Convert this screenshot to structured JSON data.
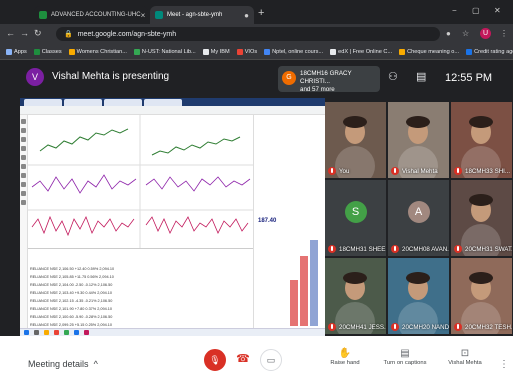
{
  "browser": {
    "tabs": [
      {
        "title": "ADVANCED ACCOUNTING-UHC",
        "icon": "classroom-icon",
        "color": "#1e8e3e"
      },
      {
        "title": "Meet - agn-sbte-ymh",
        "icon": "meet-icon",
        "color": "#00897b"
      }
    ],
    "url": "meet.google.com/agn-sbte-ymh",
    "bookmarks": [
      {
        "label": "Apps",
        "color": "#8ab4f8"
      },
      {
        "label": "Classes",
        "color": "#1e8e3e"
      },
      {
        "label": "Womens Christian...",
        "color": "#f9ab00"
      },
      {
        "label": "N-UST: National Lib...",
        "color": "#34a853"
      },
      {
        "label": "My IBM",
        "color": "#e8eaed"
      },
      {
        "label": "VIOs",
        "color": "#ea4335"
      },
      {
        "label": "Nptel, online cours...",
        "color": "#4285f4"
      },
      {
        "label": "edX | Free Online C...",
        "color": "#e8eaed"
      },
      {
        "label": "Cheque meaning o...",
        "color": "#f9ab00"
      },
      {
        "label": "Credit rating agenci...",
        "color": "#1a73e8"
      }
    ],
    "profile_initial": "U"
  },
  "meet": {
    "presenter_initial": "V",
    "presenter_text": "Vishal Mehta is presenting",
    "pinned": {
      "initial": "G",
      "name": "18CMH16 GRACY CHRISTI...",
      "more": "and 57 more"
    },
    "time": "12:55 PM",
    "participants": [
      {
        "name": "You",
        "kind": "video",
        "bg": "#6d5a4e"
      },
      {
        "name": "Vishal Mehta",
        "kind": "video",
        "bg": "#8a7d72"
      },
      {
        "name": "18CMH33 SHI...",
        "kind": "video",
        "bg": "#7c5044"
      },
      {
        "name": "18CMH31 SHEE...",
        "kind": "avatar",
        "initial": "S",
        "avatar_color": "#43a047",
        "bg": "#3c4043"
      },
      {
        "name": "20CMH08 AVAN...",
        "kind": "avatar",
        "initial": "A",
        "avatar_color": "#a1887f",
        "bg": "#3c4043"
      },
      {
        "name": "20CMH31 SWAT...",
        "kind": "video",
        "bg": "#5d4a45"
      },
      {
        "name": "20CMH41 JESS...",
        "kind": "video",
        "bg": "#4c5a4a"
      },
      {
        "name": "20CMH20 NAND...",
        "kind": "video",
        "bg": "#3f6f8a"
      },
      {
        "name": "20CMH32 TESH...",
        "kind": "video",
        "bg": "#8f6a5a"
      }
    ]
  },
  "shared_screen": {
    "table_rows": [
      "RELIANCE  NSE  2,106.50  +12.40  0.59%  2,094.10",
      "RELIANCE  NSE  2,105.85  +11.75  0.56%  2,094.10",
      "RELIANCE  NSE  2,104.00  -2.50  -0.12%  2,106.50",
      "RELIANCE  NSE  2,103.40  +9.30  0.44%  2,094.10",
      "RELIANCE  NSE  2,102.15  -4.35  -0.21%  2,106.50",
      "RELIANCE  NSE  2,101.90  +7.80  0.37%  2,094.10",
      "RELIANCE  NSE  2,100.60  -5.90  -0.28%  2,106.50",
      "RELIANCE  NSE  2,099.25  +5.15  0.25%  2,094.10"
    ],
    "price": "187.40"
  },
  "controls": {
    "meeting_details": "Meeting details",
    "raise_hand": "Raise hand",
    "present": "Turn on captions",
    "presenter": "Vishal Mehta"
  }
}
